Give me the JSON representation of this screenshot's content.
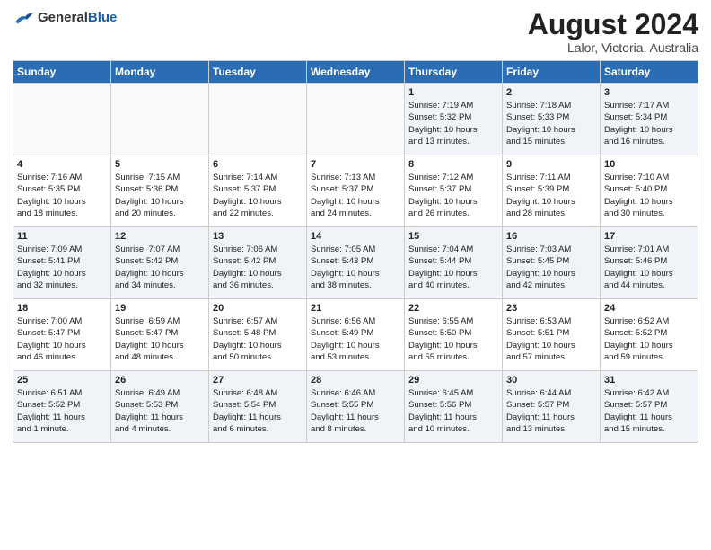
{
  "logo": {
    "general": "General",
    "blue": "Blue"
  },
  "header": {
    "month": "August 2024",
    "location": "Lalor, Victoria, Australia"
  },
  "weekdays": [
    "Sunday",
    "Monday",
    "Tuesday",
    "Wednesday",
    "Thursday",
    "Friday",
    "Saturday"
  ],
  "weeks": [
    [
      {
        "day": "",
        "info": ""
      },
      {
        "day": "",
        "info": ""
      },
      {
        "day": "",
        "info": ""
      },
      {
        "day": "",
        "info": ""
      },
      {
        "day": "1",
        "info": "Sunrise: 7:19 AM\nSunset: 5:32 PM\nDaylight: 10 hours\nand 13 minutes."
      },
      {
        "day": "2",
        "info": "Sunrise: 7:18 AM\nSunset: 5:33 PM\nDaylight: 10 hours\nand 15 minutes."
      },
      {
        "day": "3",
        "info": "Sunrise: 7:17 AM\nSunset: 5:34 PM\nDaylight: 10 hours\nand 16 minutes."
      }
    ],
    [
      {
        "day": "4",
        "info": "Sunrise: 7:16 AM\nSunset: 5:35 PM\nDaylight: 10 hours\nand 18 minutes."
      },
      {
        "day": "5",
        "info": "Sunrise: 7:15 AM\nSunset: 5:36 PM\nDaylight: 10 hours\nand 20 minutes."
      },
      {
        "day": "6",
        "info": "Sunrise: 7:14 AM\nSunset: 5:37 PM\nDaylight: 10 hours\nand 22 minutes."
      },
      {
        "day": "7",
        "info": "Sunrise: 7:13 AM\nSunset: 5:37 PM\nDaylight: 10 hours\nand 24 minutes."
      },
      {
        "day": "8",
        "info": "Sunrise: 7:12 AM\nSunset: 5:37 PM\nDaylight: 10 hours\nand 26 minutes."
      },
      {
        "day": "9",
        "info": "Sunrise: 7:11 AM\nSunset: 5:39 PM\nDaylight: 10 hours\nand 28 minutes."
      },
      {
        "day": "10",
        "info": "Sunrise: 7:10 AM\nSunset: 5:40 PM\nDaylight: 10 hours\nand 30 minutes."
      }
    ],
    [
      {
        "day": "11",
        "info": "Sunrise: 7:09 AM\nSunset: 5:41 PM\nDaylight: 10 hours\nand 32 minutes."
      },
      {
        "day": "12",
        "info": "Sunrise: 7:07 AM\nSunset: 5:42 PM\nDaylight: 10 hours\nand 34 minutes."
      },
      {
        "day": "13",
        "info": "Sunrise: 7:06 AM\nSunset: 5:42 PM\nDaylight: 10 hours\nand 36 minutes."
      },
      {
        "day": "14",
        "info": "Sunrise: 7:05 AM\nSunset: 5:43 PM\nDaylight: 10 hours\nand 38 minutes."
      },
      {
        "day": "15",
        "info": "Sunrise: 7:04 AM\nSunset: 5:44 PM\nDaylight: 10 hours\nand 40 minutes."
      },
      {
        "day": "16",
        "info": "Sunrise: 7:03 AM\nSunset: 5:45 PM\nDaylight: 10 hours\nand 42 minutes."
      },
      {
        "day": "17",
        "info": "Sunrise: 7:01 AM\nSunset: 5:46 PM\nDaylight: 10 hours\nand 44 minutes."
      }
    ],
    [
      {
        "day": "18",
        "info": "Sunrise: 7:00 AM\nSunset: 5:47 PM\nDaylight: 10 hours\nand 46 minutes."
      },
      {
        "day": "19",
        "info": "Sunrise: 6:59 AM\nSunset: 5:47 PM\nDaylight: 10 hours\nand 48 minutes."
      },
      {
        "day": "20",
        "info": "Sunrise: 6:57 AM\nSunset: 5:48 PM\nDaylight: 10 hours\nand 50 minutes."
      },
      {
        "day": "21",
        "info": "Sunrise: 6:56 AM\nSunset: 5:49 PM\nDaylight: 10 hours\nand 53 minutes."
      },
      {
        "day": "22",
        "info": "Sunrise: 6:55 AM\nSunset: 5:50 PM\nDaylight: 10 hours\nand 55 minutes."
      },
      {
        "day": "23",
        "info": "Sunrise: 6:53 AM\nSunset: 5:51 PM\nDaylight: 10 hours\nand 57 minutes."
      },
      {
        "day": "24",
        "info": "Sunrise: 6:52 AM\nSunset: 5:52 PM\nDaylight: 10 hours\nand 59 minutes."
      }
    ],
    [
      {
        "day": "25",
        "info": "Sunrise: 6:51 AM\nSunset: 5:52 PM\nDaylight: 11 hours\nand 1 minute."
      },
      {
        "day": "26",
        "info": "Sunrise: 6:49 AM\nSunset: 5:53 PM\nDaylight: 11 hours\nand 4 minutes."
      },
      {
        "day": "27",
        "info": "Sunrise: 6:48 AM\nSunset: 5:54 PM\nDaylight: 11 hours\nand 6 minutes."
      },
      {
        "day": "28",
        "info": "Sunrise: 6:46 AM\nSunset: 5:55 PM\nDaylight: 11 hours\nand 8 minutes."
      },
      {
        "day": "29",
        "info": "Sunrise: 6:45 AM\nSunset: 5:56 PM\nDaylight: 11 hours\nand 10 minutes."
      },
      {
        "day": "30",
        "info": "Sunrise: 6:44 AM\nSunset: 5:57 PM\nDaylight: 11 hours\nand 13 minutes."
      },
      {
        "day": "31",
        "info": "Sunrise: 6:42 AM\nSunset: 5:57 PM\nDaylight: 11 hours\nand 15 minutes."
      }
    ]
  ]
}
